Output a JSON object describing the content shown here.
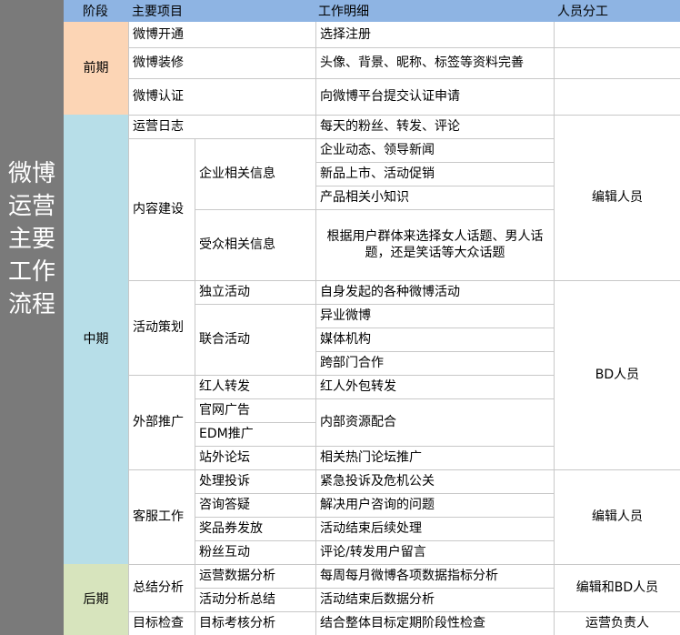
{
  "side_title": "微博运营主要工作流程",
  "header": {
    "stage": "阶段",
    "project": "主要项目",
    "detail": "工作明细",
    "staff": "人员分工"
  },
  "stages": {
    "early": "前期",
    "middle": "中期",
    "late": "后期"
  },
  "colors": {
    "early": "#fcd5b5",
    "middle": "#b7dee8",
    "late": "#d7e4bd",
    "header": "#8eb4e3",
    "side": "#7a7a7a"
  },
  "projects": {
    "weibo_open": "微博开通",
    "weibo_decor": "微博装修",
    "weibo_verify": "微博认证",
    "ops_log": "运营日志",
    "content": "内容建设",
    "activity": "活动策划",
    "external": "外部推广",
    "service": "客服工作",
    "summary": "总结分析",
    "target": "目标检查"
  },
  "subs": {
    "company_info": "企业相关信息",
    "audience_info": "受众相关信息",
    "independent": "独立活动",
    "joint": "联合活动",
    "kol_repost": "红人转发",
    "official_ads": "官网广告",
    "edm": "EDM推广",
    "forums": "站外论坛",
    "complaints": "处理投诉",
    "consulting": "咨询答疑",
    "prizes": "奖品券发放",
    "fan_interaction": "粉丝互动",
    "ops_analysis": "运营数据分析",
    "activity_analysis": "活动分析总结",
    "kpi_analysis": "目标考核分析"
  },
  "details": {
    "register": "选择注册",
    "profile": "头像、背景、昵称、标签等资料完善",
    "verify": "向微博平台提交认证申请",
    "daily": "每天的粉丝、转发、评论",
    "company_news": "企业动态、领导新闻",
    "new_products": "新品上市、活动促销",
    "tips": "产品相关小知识",
    "audience_topics": "根据用户群体来选择女人话题、男人话题，还是笑话等大众话题",
    "own_activity": "自身发起的各种微博活动",
    "cross_weibo": "异业微博",
    "media": "媒体机构",
    "cross_dept": "跨部门合作",
    "kol_outsource": "红人外包转发",
    "internal_resources": "内部资源配合",
    "forum_promo": "相关热门论坛推广",
    "crisis": "紧急投诉及危机公关",
    "user_questions": "解决用户咨询的问题",
    "post_activity": "活动结束后续处理",
    "comment_repost": "评论/转发用户留言",
    "monthly_metrics": "每周每月微博各项数据指标分析",
    "post_activity_data": "活动结束后数据分析",
    "stage_check": "结合整体目标定期阶段性检查"
  },
  "staff": {
    "editor_1": "编辑人员",
    "bd": "BD人员",
    "editor_2": "编辑人员",
    "editor_bd": "编辑和BD人员",
    "ops_lead": "运营负责人"
  }
}
